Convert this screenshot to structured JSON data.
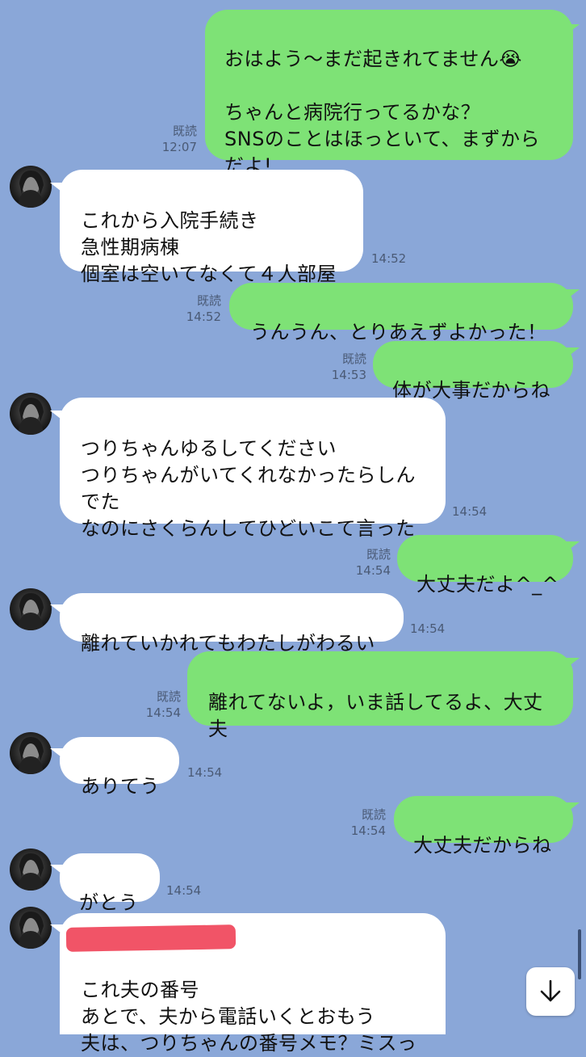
{
  "messages": [
    {
      "id": "m1",
      "sender": "me",
      "text": "おはよう〜まだ起きれてません😭\n\nちゃんと病院行ってるかな？\nSNSのことはほっといて、まずから\nだよ!",
      "read_label": "既読",
      "time": "12:07"
    },
    {
      "id": "m2",
      "sender": "them",
      "text": "これから入院手続き\n急性期病棟\n個室は空いてなくて４人部屋",
      "time": "14:52"
    },
    {
      "id": "m3",
      "sender": "me",
      "text": "うんうん、とりあえずよかった！",
      "read_label": "既読",
      "time": "14:52"
    },
    {
      "id": "m4",
      "sender": "me",
      "text": "体が大事だからね",
      "read_label": "既読",
      "time": "14:53"
    },
    {
      "id": "m5",
      "sender": "them",
      "text": "つりちゃんゆるしてください\nつりちゃんがいてくれなかったらしん\nでた\nなのにさくらんしてひどいこて言った",
      "time": "14:54"
    },
    {
      "id": "m6",
      "sender": "me",
      "text": "大丈夫だよ^_^",
      "read_label": "既読",
      "time": "14:54"
    },
    {
      "id": "m7",
      "sender": "them",
      "text": "離れていかれてもわたしがわるい",
      "time": "14:54"
    },
    {
      "id": "m8",
      "sender": "me",
      "text": "離れてないよ，いま話してるよ、大丈\n夫",
      "read_label": "既読",
      "time": "14:54"
    },
    {
      "id": "m9",
      "sender": "them",
      "text": "ありてう",
      "time": "14:54"
    },
    {
      "id": "m10",
      "sender": "me",
      "text": "大丈夫だからね",
      "read_label": "既読",
      "time": "14:54"
    },
    {
      "id": "m11",
      "sender": "them",
      "text": "がとう",
      "time": "14:54"
    },
    {
      "id": "m12",
      "sender": "them",
      "text": "これ夫の番号\nあとで、夫から電話いくとおもう\n夫は、つりちゃんの番号メモ？ミスっ",
      "time": ""
    }
  ],
  "icons": {
    "scroll_down": "arrow-down-icon",
    "avatar": "avatar-icon"
  },
  "colors": {
    "background": "#8aa7d8",
    "my_bubble": "#7ee276",
    "their_bubble": "#ffffff",
    "redaction": "#f0455a"
  }
}
